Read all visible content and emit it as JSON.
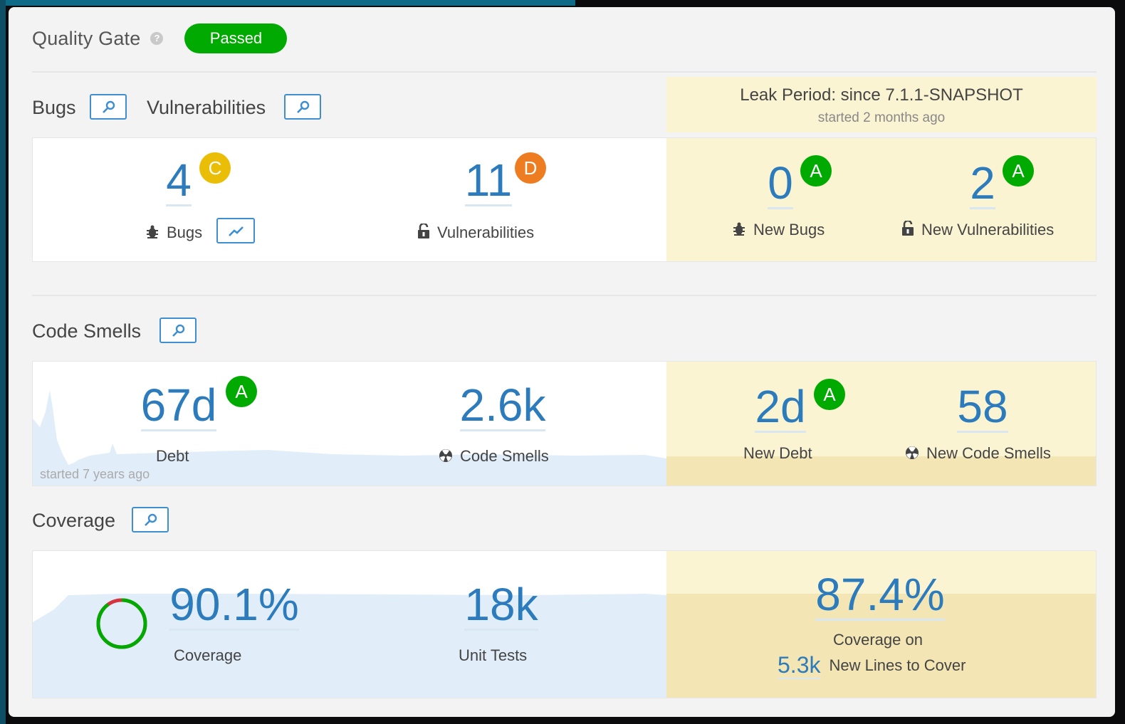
{
  "quality_gate": {
    "title": "Quality Gate",
    "status": "Passed",
    "status_color": "#00aa00"
  },
  "sections": {
    "bugs_title": "Bugs",
    "vulnerabilities_title": "Vulnerabilities",
    "code_smells_title": "Code Smells",
    "coverage_title": "Coverage"
  },
  "leak_period": {
    "title": "Leak Period: since 7.1.1-SNAPSHOT",
    "started": "started 2 months ago"
  },
  "reliability": {
    "bugs": {
      "value": "4",
      "rating": "C",
      "label": "Bugs"
    },
    "vulnerabilities": {
      "value": "11",
      "rating": "D",
      "label": "Vulnerabilities"
    },
    "new_bugs": {
      "value": "0",
      "rating": "A",
      "label": "New Bugs"
    },
    "new_vulnerabilities": {
      "value": "2",
      "rating": "A",
      "label": "New Vulnerabilities"
    }
  },
  "maintainability": {
    "debt": {
      "value": "67d",
      "rating": "A",
      "label": "Debt"
    },
    "code_smells": {
      "value": "2.6k",
      "label": "Code Smells"
    },
    "new_debt": {
      "value": "2d",
      "rating": "A",
      "label": "New Debt"
    },
    "new_code_smells": {
      "value": "58",
      "label": "New Code Smells"
    },
    "history_started": "started 7 years ago"
  },
  "coverage": {
    "coverage": {
      "value": "90.1%",
      "label": "Coverage",
      "fraction": 0.901
    },
    "unit_tests": {
      "value": "18k",
      "label": "Unit Tests"
    },
    "new_coverage": {
      "value": "87.4%",
      "label": "Coverage on"
    },
    "new_lines": {
      "value": "5.3k",
      "label": "New Lines to Cover"
    }
  },
  "colors": {
    "accent": "#2c7cbd",
    "rating_A": "#00aa00",
    "rating_C": "#eabe06",
    "rating_D": "#ed7d20",
    "leak_bg": "#fbf4d2"
  },
  "icons": [
    "help-icon",
    "link-icon",
    "bug-icon",
    "lock-icon",
    "code-smell-icon",
    "chart-icon"
  ]
}
